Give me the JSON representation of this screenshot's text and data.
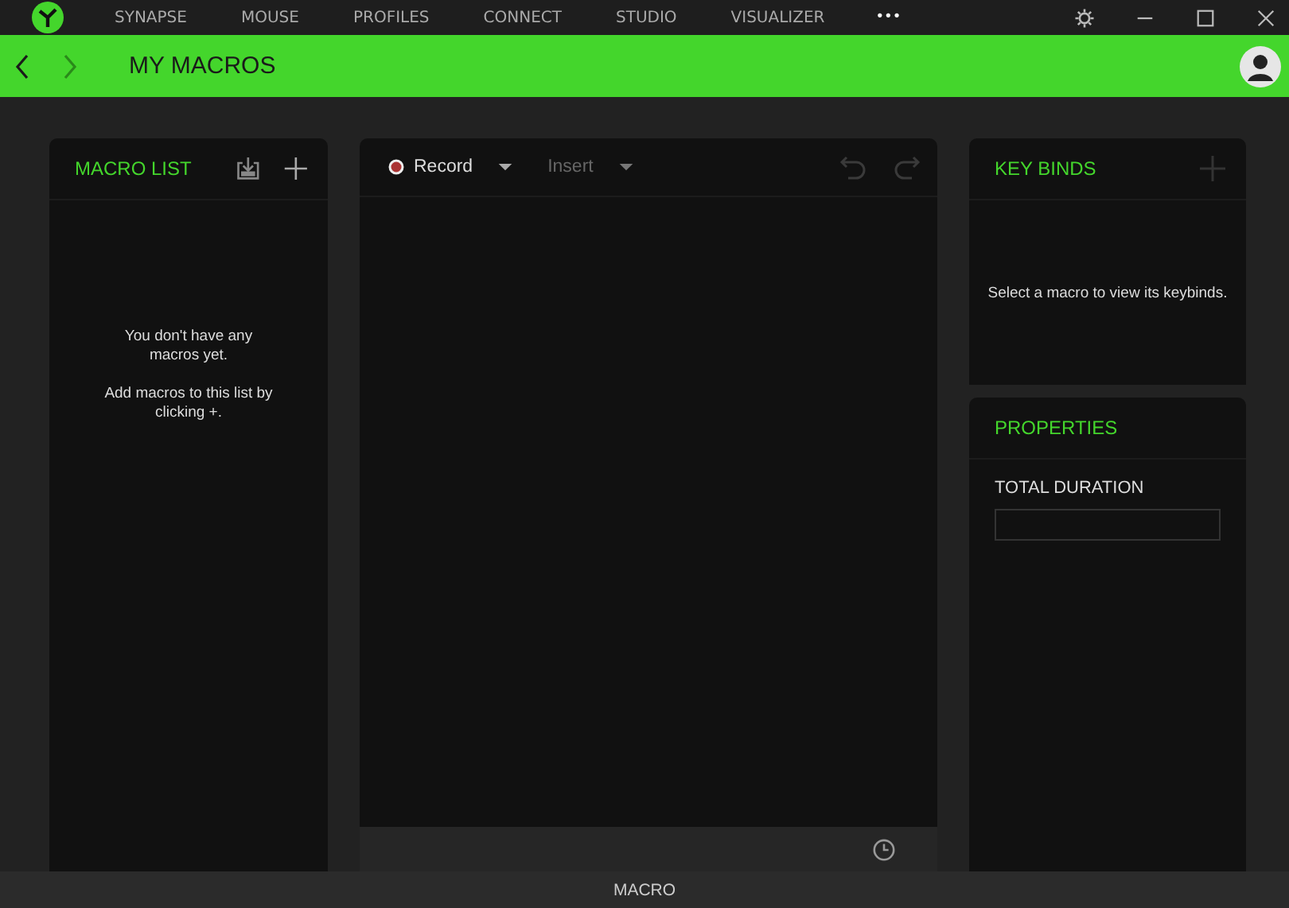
{
  "nav_tabs": [
    {
      "label": "SYNAPSE"
    },
    {
      "label": "MOUSE"
    },
    {
      "label": "PROFILES"
    },
    {
      "label": "CONNECT"
    },
    {
      "label": "STUDIO"
    },
    {
      "label": "VISUALIZER"
    }
  ],
  "more": "•••",
  "header": {
    "title": "MY MACROS",
    "back_disabled": false,
    "forward_disabled": true
  },
  "macro_list": {
    "title": "MACRO LIST",
    "empty_lines": [
      "You don't have any macros yet.",
      "Add macros to this list by clicking +."
    ]
  },
  "editor": {
    "tools": [
      {
        "label": "Record",
        "kind": "record",
        "disabled": false
      },
      {
        "label": "Insert",
        "kind": "insert",
        "disabled": true
      }
    ]
  },
  "key_binds": {
    "title": "KEY BINDS",
    "message": "Select a macro to view its keybinds."
  },
  "properties": {
    "title": "PROPERTIES",
    "field_label": "TOTAL DURATION"
  },
  "footer": {
    "label": "MACRO"
  }
}
